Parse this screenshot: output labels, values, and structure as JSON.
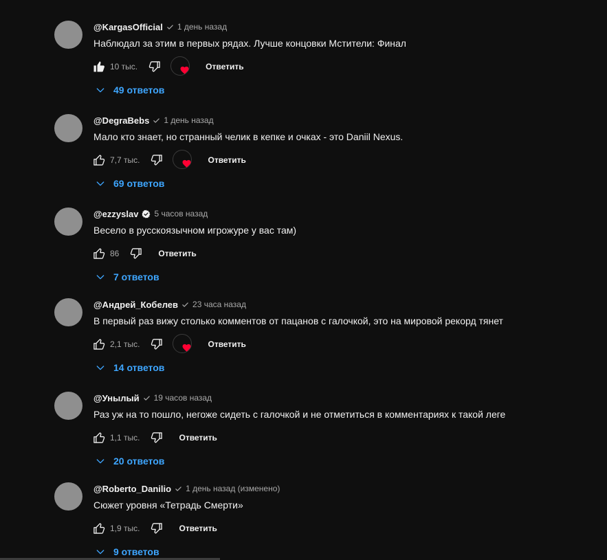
{
  "comments": [
    {
      "author": "@KargasOfficial",
      "badge": "check",
      "time": "1 день назад",
      "text": "Наблюдал за этим в первых рядах. Лучше концовки Мстители: Финал",
      "likes": "10 тыс.",
      "liked": true,
      "creator_heart": true,
      "reply_label": "Ответить",
      "replies_label": "49 ответов"
    },
    {
      "author": "@DegraBebs",
      "badge": "check",
      "time": "1 день назад",
      "text": "Мало кто знает, но странный челик в кепке и очках - это Daniil Nexus.",
      "likes": "7,7 тыс.",
      "liked": false,
      "creator_heart": true,
      "reply_label": "Ответить",
      "replies_label": "69 ответов"
    },
    {
      "author": "@ezzyslav",
      "badge": "verified",
      "time": "5 часов назад",
      "text": "Весело в русскоязычном игрожуре у вас там)",
      "likes": "86",
      "liked": false,
      "creator_heart": false,
      "reply_label": "Ответить",
      "replies_label": "7 ответов"
    },
    {
      "author": "@Андрей_Кобелев",
      "badge": "check",
      "time": "23 часа назад",
      "text": "В первый раз вижу столько комментов от пацанов с галочкой, это на мировой рекорд тянет",
      "likes": "2,1 тыс.",
      "liked": false,
      "creator_heart": true,
      "reply_label": "Ответить",
      "replies_label": "14 ответов"
    },
    {
      "author": "@Унылый",
      "badge": "check",
      "time": "19 часов назад",
      "text": "Раз уж на то пошло, негоже сидеть с галочкой и не отметиться в комментариях к такой леге",
      "likes": "1,1 тыс.",
      "liked": false,
      "creator_heart": false,
      "reply_label": "Ответить",
      "replies_label": "20 ответов"
    },
    {
      "author": "@Roberto_Danilio",
      "badge": "check",
      "time": "1 день назад (изменено)",
      "text": "Сюжет уровня «Тетрадь Смерти»",
      "likes": "1,9 тыс.",
      "liked": false,
      "creator_heart": false,
      "reply_label": "Ответить",
      "replies_label": "9 ответов"
    }
  ],
  "colors": {
    "background": "#0f0f0f",
    "text": "#f1f1f1",
    "secondary_text": "#aaaaaa",
    "link_blue": "#3ea6ff",
    "heart_red": "#ff0033",
    "avatar_gray": "#8f8f8f"
  },
  "icons": {
    "like": "thumb-up-icon",
    "dislike": "thumb-down-icon",
    "heart": "heart-icon",
    "chevron": "chevron-down-icon",
    "badge_check": "check-badge-icon",
    "badge_verified": "verified-badge-icon"
  }
}
